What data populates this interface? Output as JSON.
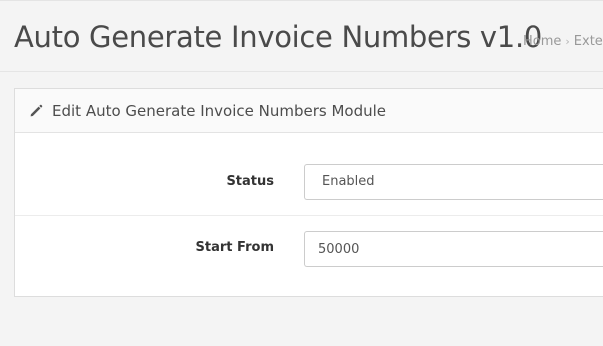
{
  "header": {
    "title": "Auto Generate Invoice Numbers v1.0",
    "breadcrumb": [
      {
        "label": "Home"
      },
      {
        "label": "Exte"
      }
    ],
    "breadcrumb_separator": "›"
  },
  "panel": {
    "icon": "pencil-icon",
    "title": "Edit Auto Generate Invoice Numbers Module"
  },
  "form": {
    "status": {
      "label": "Status",
      "value": "Enabled"
    },
    "start_from": {
      "label": "Start From",
      "value": "50000"
    }
  }
}
